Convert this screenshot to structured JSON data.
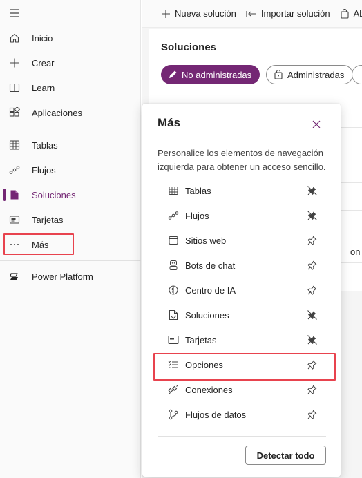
{
  "leftnav": {
    "items": [
      {
        "label": "Inicio",
        "icon": "home-icon"
      },
      {
        "label": "Crear",
        "icon": "plus-icon"
      },
      {
        "label": "Learn",
        "icon": "book-icon"
      },
      {
        "label": "Aplicaciones",
        "icon": "apps-icon"
      },
      {
        "label": "Tablas",
        "icon": "table-icon"
      },
      {
        "label": "Flujos",
        "icon": "flow-icon"
      },
      {
        "label": "Soluciones",
        "icon": "solutions-icon"
      },
      {
        "label": "Tarjetas",
        "icon": "cards-icon"
      },
      {
        "label": "Más",
        "icon": "more-icon"
      },
      {
        "label": "Power Platform",
        "icon": "power-platform-icon"
      }
    ]
  },
  "cmdbar": {
    "new_solution": "Nueva solución",
    "import_solution": "Importar solución",
    "third": "Ab"
  },
  "main": {
    "title": "Soluciones",
    "pill_unmanaged": "No administradas",
    "pill_managed": "Administradas",
    "partial_text": "on"
  },
  "panel": {
    "title": "Más",
    "description": "Personalice los elementos de navegación izquierda para obtener un acceso sencillo.",
    "items": [
      {
        "label": "Tablas",
        "icon": "table-icon",
        "pinned": true
      },
      {
        "label": "Flujos",
        "icon": "flow-icon",
        "pinned": true
      },
      {
        "label": "Sitios web",
        "icon": "website-icon",
        "pinned": false
      },
      {
        "label": "Bots de chat",
        "icon": "bot-icon",
        "pinned": false
      },
      {
        "label": "Centro de IA",
        "icon": "ai-hub-icon",
        "pinned": false
      },
      {
        "label": "Soluciones",
        "icon": "solutions-icon",
        "pinned": true
      },
      {
        "label": "Tarjetas",
        "icon": "cards-icon",
        "pinned": true
      },
      {
        "label": "Opciones",
        "icon": "choices-icon",
        "pinned": false
      },
      {
        "label": "Conexiones",
        "icon": "connections-icon",
        "pinned": false
      },
      {
        "label": "Flujos de datos",
        "icon": "dataflows-icon",
        "pinned": false
      }
    ],
    "detect_all": "Detectar todo"
  },
  "colors": {
    "accent": "#742774",
    "highlight": "#e8434e"
  }
}
